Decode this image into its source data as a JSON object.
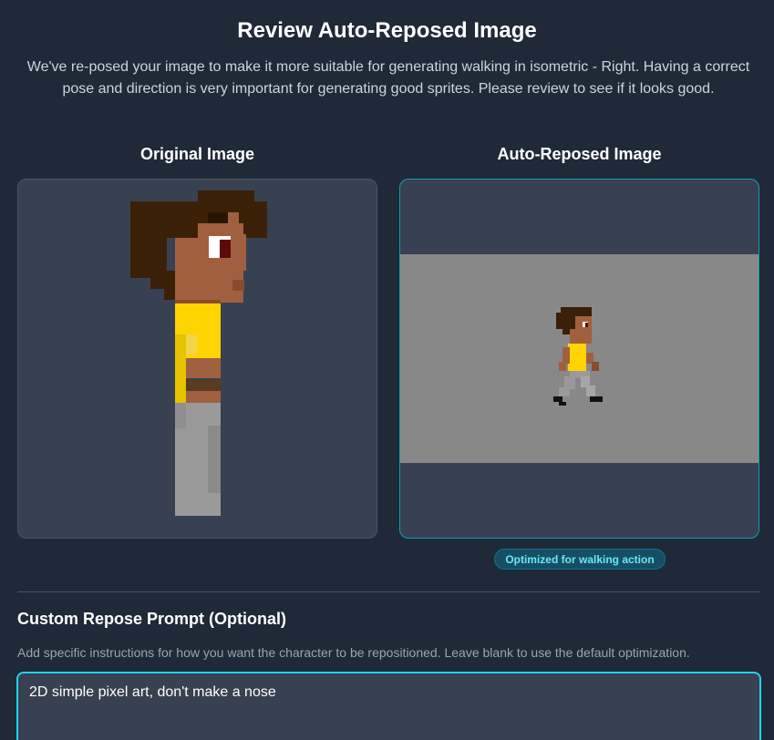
{
  "header": {
    "title": "Review Auto-Reposed Image",
    "subtitle": "We've re-posed your image to make it more suitable for generating walking in isometric - Right. Having a correct pose and direction is very important for generating good sprites. Please review to see if it looks good."
  },
  "original": {
    "label": "Original Image"
  },
  "reposed": {
    "label": "Auto-Reposed Image",
    "badge": "Optimized for walking action"
  },
  "custom_prompt": {
    "title": "Custom Repose Prompt (Optional)",
    "hint": "Add specific instructions for how you want the character to be repositioned. Leave blank to use the default optimization.",
    "value": "2D simple pixel art, don't make a nose"
  },
  "colors": {
    "accent": "#22d3ee",
    "panel_bg": "#374151",
    "page_bg": "#1f2937"
  }
}
